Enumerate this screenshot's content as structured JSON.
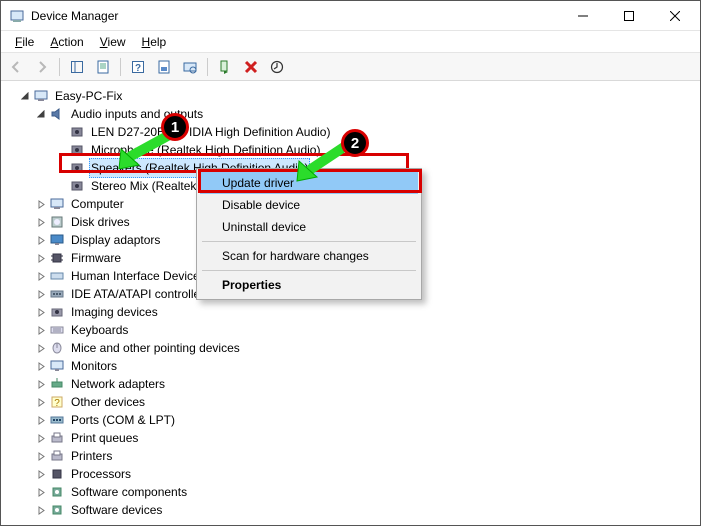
{
  "window": {
    "title": "Device Manager"
  },
  "menu": {
    "file": "File",
    "action": "Action",
    "view": "View",
    "help": "Help"
  },
  "tree": {
    "root": "Easy-PC-Fix",
    "audio_category": "Audio inputs and outputs",
    "audio_children": {
      "len": "LEN D27-20B (NVIDIA High Definition Audio)",
      "microphone": "Microphone (Realtek High Definition Audio)",
      "speakers": "Speakers (Realtek High Definition Audio)",
      "stereomix": "Stereo Mix (Realtek H"
    },
    "categories": [
      "Computer",
      "Disk drives",
      "Display adaptors",
      "Firmware",
      "Human Interface Device",
      "IDE ATA/ATAPI controlle",
      "Imaging devices",
      "Keyboards",
      "Mice and other pointing devices",
      "Monitors",
      "Network adapters",
      "Other devices",
      "Ports (COM & LPT)",
      "Print queues",
      "Printers",
      "Processors",
      "Software components",
      "Software devices"
    ]
  },
  "context_menu": {
    "update": "Update driver",
    "disable": "Disable device",
    "uninstall": "Uninstall device",
    "scan": "Scan for hardware changes",
    "properties": "Properties"
  },
  "annotations": {
    "badge1": "1",
    "badge2": "2"
  }
}
